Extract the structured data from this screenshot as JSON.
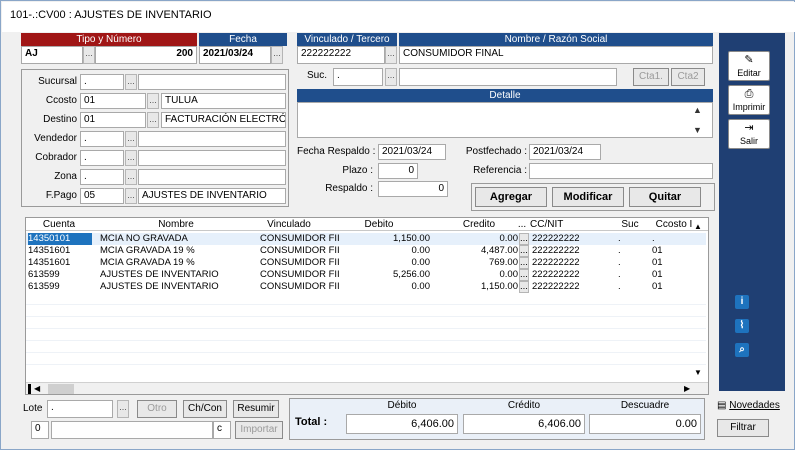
{
  "window": {
    "title": "101-.:CV00 : AJUSTES DE INVENTARIO"
  },
  "doc": {
    "tipo_header": "Tipo y Número",
    "fecha_header": "Fecha",
    "tipo": "AJ",
    "numero": "200",
    "fecha": "2021/03/24"
  },
  "tercero": {
    "vinculado_header": "Vinculado / Tercero",
    "nombre_header": "Nombre / Razón Social",
    "vinculado": "222222222",
    "nombre": "CONSUMIDOR FINAL",
    "suc_label": "Suc.",
    "suc": ".",
    "cta1": "Cta1.",
    "cta2": "Cta2",
    "detalle_header": "Detalle"
  },
  "left": {
    "sucursal_label": "Sucursal",
    "sucursal": ".",
    "ccosto_label": "Ccosto",
    "ccosto": "01",
    "ccosto_name": "TULUA",
    "destino_label": "Destino",
    "destino": "01",
    "destino_name": "FACTURACIÓN ELECTRÓI",
    "vendedor_label": "Vendedor",
    "vendedor": ".",
    "cobrador_label": "Cobrador",
    "cobrador": ".",
    "zona_label": "Zona",
    "zona": ".",
    "fpago_label": "F.Pago",
    "fpago": "05",
    "fpago_name": "AJUSTES DE INVENTARIO"
  },
  "misc": {
    "fecha_respaldo_label": "Fecha Respaldo :",
    "fecha_respaldo": "2021/03/24",
    "postfechado_label": "Postfechado :",
    "postfechado": "2021/03/24",
    "plazo_label": "Plazo :",
    "plazo": "0",
    "referencia_label": "Referencia :",
    "referencia": "",
    "respaldo_label": "Respaldo :",
    "respaldo": "0"
  },
  "actions": {
    "agregar": "Agregar",
    "modificar": "Modificar",
    "quitar": "Quitar"
  },
  "sidebar": {
    "editar": "Editar",
    "imprimir": "Imprimir",
    "salir": "Salir"
  },
  "grid": {
    "columns": [
      "Cuenta",
      "Nombre",
      "Vinculado",
      "Debito",
      "Credito",
      "...",
      "CC/NIT",
      "Suc",
      "Ccosto I"
    ],
    "rows": [
      [
        "14350101",
        "MCIA NO GRAVADA",
        "CONSUMIDOR FII",
        "1,150.00",
        "0.00",
        "...",
        "222222222",
        ".",
        "."
      ],
      [
        "14351601",
        "MCIA GRAVADA 19 %",
        "CONSUMIDOR FII",
        "0.00",
        "4,487.00",
        "...",
        "222222222",
        ".",
        "01"
      ],
      [
        "14351601",
        "MCIA GRAVADA 19 %",
        "CONSUMIDOR FII",
        "0.00",
        "769.00",
        "...",
        "222222222",
        ".",
        "01"
      ],
      [
        "613599",
        "AJUSTES DE INVENTARIO",
        "CONSUMIDOR FII",
        "5,256.00",
        "0.00",
        "...",
        "222222222",
        ".",
        "01"
      ],
      [
        "613599",
        "AJUSTES DE INVENTARIO",
        "CONSUMIDOR FII",
        "0.00",
        "1,150.00",
        "...",
        "222222222",
        ".",
        "01"
      ]
    ]
  },
  "bottom": {
    "lote_label": "Lote",
    "lote": ".",
    "otro": "Otro",
    "chcon": "Ch/Con",
    "resumir": "Resumir",
    "counter": "0",
    "c_value": "c",
    "importar": "Importar"
  },
  "totals": {
    "total_label": "Total :",
    "debito_header": "Débito",
    "credito_header": "Crédito",
    "descuadre_header": "Descuadre",
    "debito": "6,406.00",
    "credito": "6,406.00",
    "descuadre": "0.00"
  },
  "right_panel": {
    "novedades": "Novedades",
    "filtrar": "Filtrar"
  },
  "colors": {
    "red_header": "#a01616",
    "blue_header": "#1f4e8c",
    "selection": "#1e73be"
  }
}
